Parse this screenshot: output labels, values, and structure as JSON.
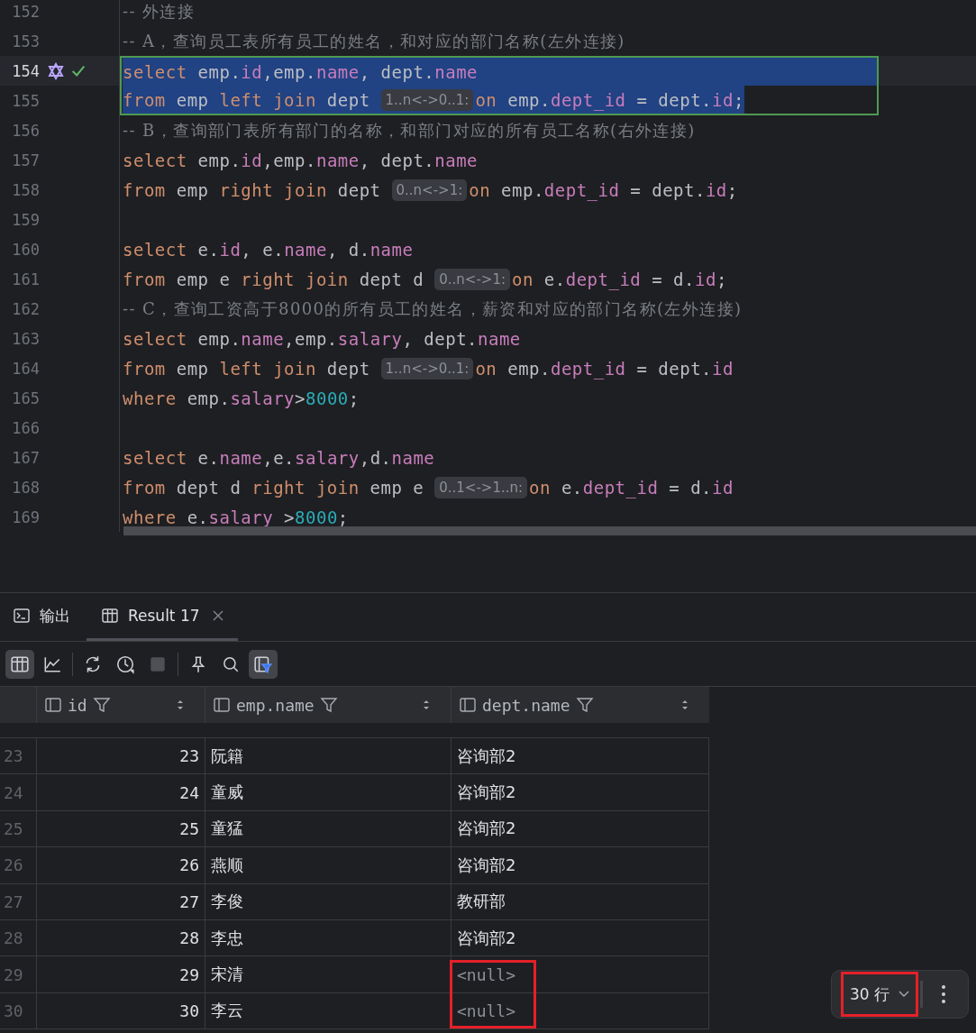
{
  "editor": {
    "lines": [
      {
        "number": "152",
        "selected": false,
        "current": false,
        "outlined": false,
        "tokens": [
          {
            "kind": "comment",
            "t": "-- 外连接"
          }
        ]
      },
      {
        "number": "153",
        "selected": false,
        "current": false,
        "outlined": false,
        "tokens": [
          {
            "kind": "comment",
            "t": "-- A，查询员工表所有员工的姓名，和对应的部门名称(左外连接)"
          }
        ]
      },
      {
        "number": "154",
        "selected": true,
        "current": true,
        "outlined": true,
        "tokens": [
          {
            "kind": "kw",
            "t": "select"
          },
          {
            "kind": "plain",
            "t": " emp."
          },
          {
            "kind": "field",
            "t": "id"
          },
          {
            "kind": "plain",
            "t": ",emp."
          },
          {
            "kind": "field",
            "t": "name"
          },
          {
            "kind": "plain",
            "t": ", dept."
          },
          {
            "kind": "field",
            "t": "name"
          }
        ]
      },
      {
        "number": "155",
        "selected": true,
        "current": false,
        "outlined": true,
        "tokens": [
          {
            "kind": "kw",
            "t": "from"
          },
          {
            "kind": "plain",
            "t": " emp "
          },
          {
            "kind": "kw",
            "t": "left join"
          },
          {
            "kind": "plain",
            "t": " dept "
          },
          {
            "kind": "hint",
            "t": "1..n<->0..1:"
          },
          {
            "kind": "kw",
            "t": "on"
          },
          {
            "kind": "plain",
            "t": " emp."
          },
          {
            "kind": "field",
            "t": "dept_id"
          },
          {
            "kind": "plain",
            "t": " = dept."
          },
          {
            "kind": "field",
            "t": "id"
          },
          {
            "kind": "plain",
            "t": ";"
          }
        ]
      },
      {
        "number": "156",
        "selected": false,
        "current": false,
        "outlined": false,
        "tokens": [
          {
            "kind": "comment",
            "t": "-- B，查询部门表所有部门的名称，和部门对应的所有员工名称(右外连接)"
          }
        ]
      },
      {
        "number": "157",
        "selected": false,
        "current": false,
        "outlined": false,
        "tokens": [
          {
            "kind": "kw",
            "t": "select"
          },
          {
            "kind": "plain",
            "t": " emp."
          },
          {
            "kind": "field",
            "t": "id"
          },
          {
            "kind": "plain",
            "t": ",emp."
          },
          {
            "kind": "field",
            "t": "name"
          },
          {
            "kind": "plain",
            "t": ", dept."
          },
          {
            "kind": "field",
            "t": "name"
          }
        ]
      },
      {
        "number": "158",
        "selected": false,
        "current": false,
        "outlined": false,
        "tokens": [
          {
            "kind": "kw",
            "t": "from"
          },
          {
            "kind": "plain",
            "t": " emp "
          },
          {
            "kind": "kw",
            "t": "right join"
          },
          {
            "kind": "plain",
            "t": " dept "
          },
          {
            "kind": "hint",
            "t": "0..n<->1:"
          },
          {
            "kind": "kw",
            "t": "on"
          },
          {
            "kind": "plain",
            "t": " emp."
          },
          {
            "kind": "field",
            "t": "dept_id"
          },
          {
            "kind": "plain",
            "t": " = dept."
          },
          {
            "kind": "field",
            "t": "id"
          },
          {
            "kind": "plain",
            "t": ";"
          }
        ]
      },
      {
        "number": "159",
        "selected": false,
        "current": false,
        "outlined": false
      },
      {
        "number": "160",
        "selected": false,
        "current": false,
        "outlined": false,
        "tokens": [
          {
            "kind": "kw",
            "t": "select"
          },
          {
            "kind": "plain",
            "t": " e."
          },
          {
            "kind": "field",
            "t": "id"
          },
          {
            "kind": "plain",
            "t": ", e."
          },
          {
            "kind": "field",
            "t": "name"
          },
          {
            "kind": "plain",
            "t": ", d."
          },
          {
            "kind": "field",
            "t": "name"
          }
        ]
      },
      {
        "number": "161",
        "selected": false,
        "current": false,
        "outlined": false,
        "tokens": [
          {
            "kind": "kw",
            "t": "from"
          },
          {
            "kind": "plain",
            "t": " emp e "
          },
          {
            "kind": "kw",
            "t": "right join"
          },
          {
            "kind": "plain",
            "t": " dept d "
          },
          {
            "kind": "hint",
            "t": "0..n<->1:"
          },
          {
            "kind": "kw",
            "t": "on"
          },
          {
            "kind": "plain",
            "t": " e."
          },
          {
            "kind": "field",
            "t": "dept_id"
          },
          {
            "kind": "plain",
            "t": " = d."
          },
          {
            "kind": "field",
            "t": "id"
          },
          {
            "kind": "plain",
            "t": ";"
          }
        ]
      },
      {
        "number": "162",
        "selected": false,
        "current": false,
        "outlined": false,
        "tokens": [
          {
            "kind": "comment",
            "t": "-- C，查询工资高于8000的所有员工的姓名，薪资和对应的部门名称(左外连接)"
          }
        ]
      },
      {
        "number": "163",
        "selected": false,
        "current": false,
        "outlined": false,
        "tokens": [
          {
            "kind": "kw",
            "t": "select"
          },
          {
            "kind": "plain",
            "t": " emp."
          },
          {
            "kind": "field",
            "t": "name"
          },
          {
            "kind": "plain",
            "t": ",emp."
          },
          {
            "kind": "field",
            "t": "salary"
          },
          {
            "kind": "plain",
            "t": ", dept."
          },
          {
            "kind": "field",
            "t": "name"
          }
        ]
      },
      {
        "number": "164",
        "selected": false,
        "current": false,
        "outlined": false,
        "tokens": [
          {
            "kind": "kw",
            "t": "from"
          },
          {
            "kind": "plain",
            "t": " emp "
          },
          {
            "kind": "kw",
            "t": "left join"
          },
          {
            "kind": "plain",
            "t": " dept "
          },
          {
            "kind": "hint",
            "t": "1..n<->0..1:"
          },
          {
            "kind": "kw",
            "t": "on"
          },
          {
            "kind": "plain",
            "t": " emp."
          },
          {
            "kind": "field",
            "t": "dept_id"
          },
          {
            "kind": "plain",
            "t": " = dept."
          },
          {
            "kind": "field",
            "t": "id"
          }
        ]
      },
      {
        "number": "165",
        "selected": false,
        "current": false,
        "outlined": false,
        "tokens": [
          {
            "kind": "kw",
            "t": "where"
          },
          {
            "kind": "plain",
            "t": " emp."
          },
          {
            "kind": "field",
            "t": "salary"
          },
          {
            "kind": "plain",
            "t": ">"
          },
          {
            "kind": "num",
            "t": "8000"
          },
          {
            "kind": "plain",
            "t": ";"
          }
        ]
      },
      {
        "number": "166",
        "selected": false,
        "current": false,
        "outlined": false
      },
      {
        "number": "167",
        "selected": false,
        "current": false,
        "outlined": false,
        "tokens": [
          {
            "kind": "kw",
            "t": "select"
          },
          {
            "kind": "plain",
            "t": " e."
          },
          {
            "kind": "field",
            "t": "name"
          },
          {
            "kind": "plain",
            "t": ",e."
          },
          {
            "kind": "field",
            "t": "salary"
          },
          {
            "kind": "plain",
            "t": ",d."
          },
          {
            "kind": "field",
            "t": "name"
          }
        ]
      },
      {
        "number": "168",
        "selected": false,
        "current": false,
        "outlined": false,
        "tokens": [
          {
            "kind": "kw",
            "t": "from"
          },
          {
            "kind": "plain",
            "t": " dept d "
          },
          {
            "kind": "kw",
            "t": "right join"
          },
          {
            "kind": "plain",
            "t": " emp e "
          },
          {
            "kind": "hint",
            "t": "0..1<->1..n:"
          },
          {
            "kind": "kw",
            "t": "on"
          },
          {
            "kind": "plain",
            "t": " e."
          },
          {
            "kind": "field",
            "t": "dept_id"
          },
          {
            "kind": "plain",
            "t": " = d."
          },
          {
            "kind": "field",
            "t": "id"
          }
        ]
      },
      {
        "number": "169",
        "selected": false,
        "current": false,
        "outlined": false,
        "tokens": [
          {
            "kind": "kw",
            "t": "where"
          },
          {
            "kind": "plain",
            "t": " e."
          },
          {
            "kind": "field",
            "t": "salary"
          },
          {
            "kind": "plain",
            "t": " >"
          },
          {
            "kind": "num",
            "t": "8000"
          },
          {
            "kind": "plain",
            "t": ";"
          }
        ]
      }
    ]
  },
  "tabs": [
    {
      "label": "输出",
      "kind": "output",
      "selected": false,
      "closable": false
    },
    {
      "label": "Result 17",
      "kind": "result",
      "selected": true,
      "closable": true
    }
  ],
  "toolbar": [
    {
      "kind": "table",
      "selected": true,
      "disabled": false
    },
    {
      "kind": "chart",
      "selected": false,
      "disabled": false
    },
    {
      "kind": "sep"
    },
    {
      "kind": "refresh",
      "selected": false,
      "disabled": false
    },
    {
      "kind": "history",
      "selected": false,
      "disabled": false
    },
    {
      "kind": "stop",
      "selected": false,
      "disabled": true
    },
    {
      "kind": "sep"
    },
    {
      "kind": "pin",
      "selected": false,
      "disabled": false
    },
    {
      "kind": "search",
      "selected": false,
      "disabled": false
    },
    {
      "kind": "filter-panel",
      "selected": true,
      "disabled": false
    }
  ],
  "table": {
    "columns": [
      "id",
      "emp.name",
      "dept.name"
    ],
    "rows": [
      {
        "row": "23",
        "id": "23",
        "name": "阮籍",
        "dept": "咨询部2",
        "is_null": false,
        "annotated": false
      },
      {
        "row": "24",
        "id": "24",
        "name": "童威",
        "dept": "咨询部2",
        "is_null": false,
        "annotated": false
      },
      {
        "row": "25",
        "id": "25",
        "name": "童猛",
        "dept": "咨询部2",
        "is_null": false,
        "annotated": false
      },
      {
        "row": "26",
        "id": "26",
        "name": "燕顺",
        "dept": "咨询部2",
        "is_null": false,
        "annotated": false
      },
      {
        "row": "27",
        "id": "27",
        "name": "李俊",
        "dept": "教研部",
        "is_null": false,
        "annotated": false
      },
      {
        "row": "28",
        "id": "28",
        "name": "李忠",
        "dept": "咨询部2",
        "is_null": false,
        "annotated": false
      },
      {
        "row": "29",
        "id": "29",
        "name": "宋清",
        "dept": "<null>",
        "is_null": true,
        "annotated": true
      },
      {
        "row": "30",
        "id": "30",
        "name": "李云",
        "dept": "<null>",
        "is_null": true,
        "annotated": true
      }
    ]
  },
  "row_count": {
    "label": "30 行",
    "annotated": true
  }
}
